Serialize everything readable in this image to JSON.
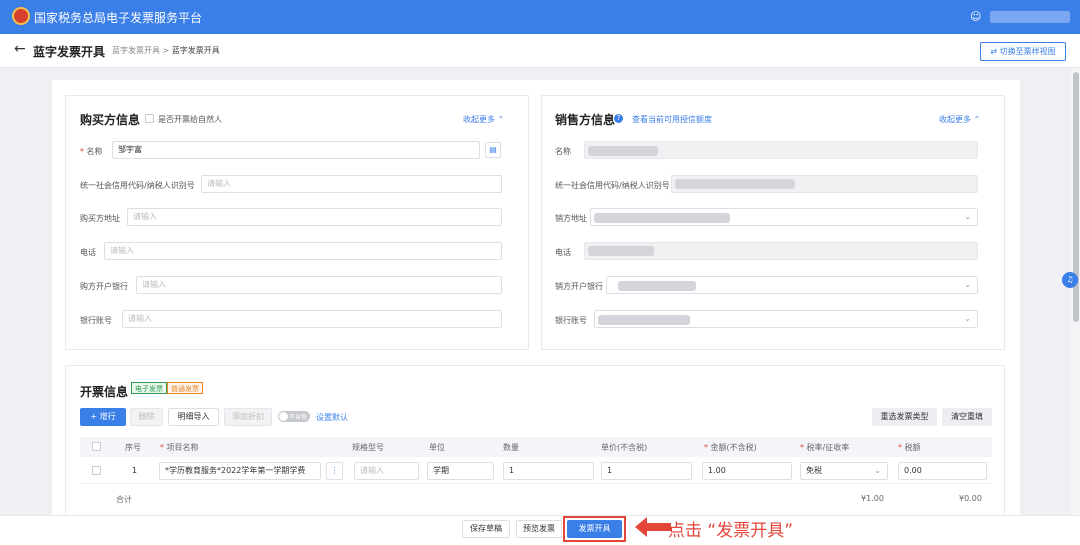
{
  "app": {
    "title": "国家税务总局电子发票服务平台"
  },
  "header": {
    "back_icon": "←",
    "page_title": "蓝字发票开具",
    "breadcrumb_parent": "蓝字发票开具",
    "breadcrumb_sep": ">",
    "breadcrumb_current": "蓝字发票开具",
    "switch_label": "切换至票样视图",
    "user_icon": "user-icon"
  },
  "buyer": {
    "title": "购买方信息",
    "natural_person_label": "是否开票给自然人",
    "collapse_label": "收起更多 ⌃",
    "name_label": "名称",
    "name_value": "邹宇富",
    "taxid_label": "统一社会信用代码/纳税人识别号",
    "taxid_placeholder": "请输入",
    "address_label": "购买方地址",
    "address_placeholder": "请输入",
    "phone_label": "电话",
    "phone_placeholder": "请输入",
    "bank_label": "购方开户银行",
    "bank_placeholder": "请输入",
    "account_label": "银行账号",
    "account_placeholder": "请输入"
  },
  "seller": {
    "title": "销售方信息",
    "credit_link": "查看当前可用授信额度",
    "collapse_label": "收起更多 ⌃",
    "name_label": "名称",
    "taxid_label": "统一社会信用代码/纳税人识别号",
    "address_label": "销方地址",
    "phone_label": "电话",
    "bank_label": "销方开户银行",
    "account_label": "银行账号"
  },
  "invoice": {
    "title": "开票信息",
    "tag_electronic": "电子发票",
    "tag_ordinary": "普通发票",
    "buttons": {
      "add_row": "+ 增行",
      "delete": "删除",
      "import_detail": "明细导入",
      "add_discount": "添加折扣",
      "tax_inclusive_toggle": "不含税",
      "set_default": "设置默认",
      "reselect_type": "重选发票类型",
      "clear_refill": "清空重填"
    },
    "columns": [
      "序号",
      "项目名称",
      "规格型号",
      "单位",
      "数量",
      "单价(不含税)",
      "金额(不含税)",
      "税率/征收率",
      "税额"
    ],
    "row": {
      "index": "1",
      "item_name": "*学历教育服务*2022学年第一学期学费",
      "spec_placeholder": "请输入",
      "unit": "学期",
      "quantity": "1",
      "unit_price": "1",
      "amount": "1.00",
      "tax_rate": "免税",
      "tax_amount": "0.00"
    },
    "total_label": "合计",
    "total_amount": "¥1.00",
    "total_tax": "¥0.00"
  },
  "footer": {
    "save_draft": "保存草稿",
    "preview": "预览发票",
    "issue": "发票开具"
  },
  "annotation": {
    "text": "点击 “发票开具”"
  },
  "colors": {
    "primary": "#3a7ee8",
    "annotation": "#e5463a"
  }
}
